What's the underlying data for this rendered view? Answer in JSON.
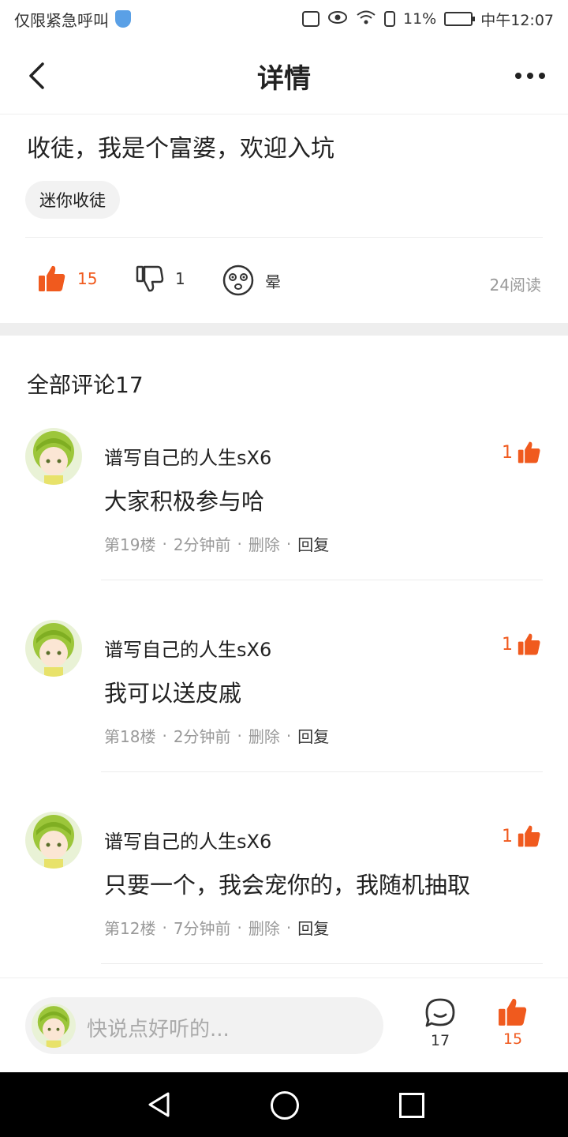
{
  "status_bar": {
    "left_text": "仅限紧急呼叫",
    "battery": "11%",
    "time": "中午12:07"
  },
  "nav": {
    "title": "详情",
    "back_icon": "chevron-left-icon",
    "more_icon": "more-horizontal-icon"
  },
  "post": {
    "text": "收徒，我是个富婆，欢迎入坑",
    "tag": "迷你收徒",
    "likes": "15",
    "dislikes": "1",
    "dizzy_label": "晕",
    "reads": "24阅读"
  },
  "comments_header": "全部评论17",
  "comments": [
    {
      "author": "谱写自己的人生sX6",
      "likes": "1",
      "text": "大家积极参与哈",
      "floor": "第19楼",
      "time": "2分钟前",
      "delete_label": "删除",
      "reply_label": "回复"
    },
    {
      "author": "谱写自己的人生sX6",
      "likes": "1",
      "text": "我可以送皮戚",
      "floor": "第18楼",
      "time": "2分钟前",
      "delete_label": "删除",
      "reply_label": "回复"
    },
    {
      "author": "谱写自己的人生sX6",
      "likes": "1",
      "text": "只要一个，我会宠你的，我随机抽取",
      "floor": "第12楼",
      "time": "7分钟前",
      "delete_label": "删除",
      "reply_label": "回复"
    }
  ],
  "bottom_bar": {
    "placeholder": "快说点好听的...",
    "comment_count": "17",
    "like_count": "15"
  },
  "colors": {
    "accent": "#f05a1e",
    "muted": "#999999",
    "divider": "#ececec"
  }
}
